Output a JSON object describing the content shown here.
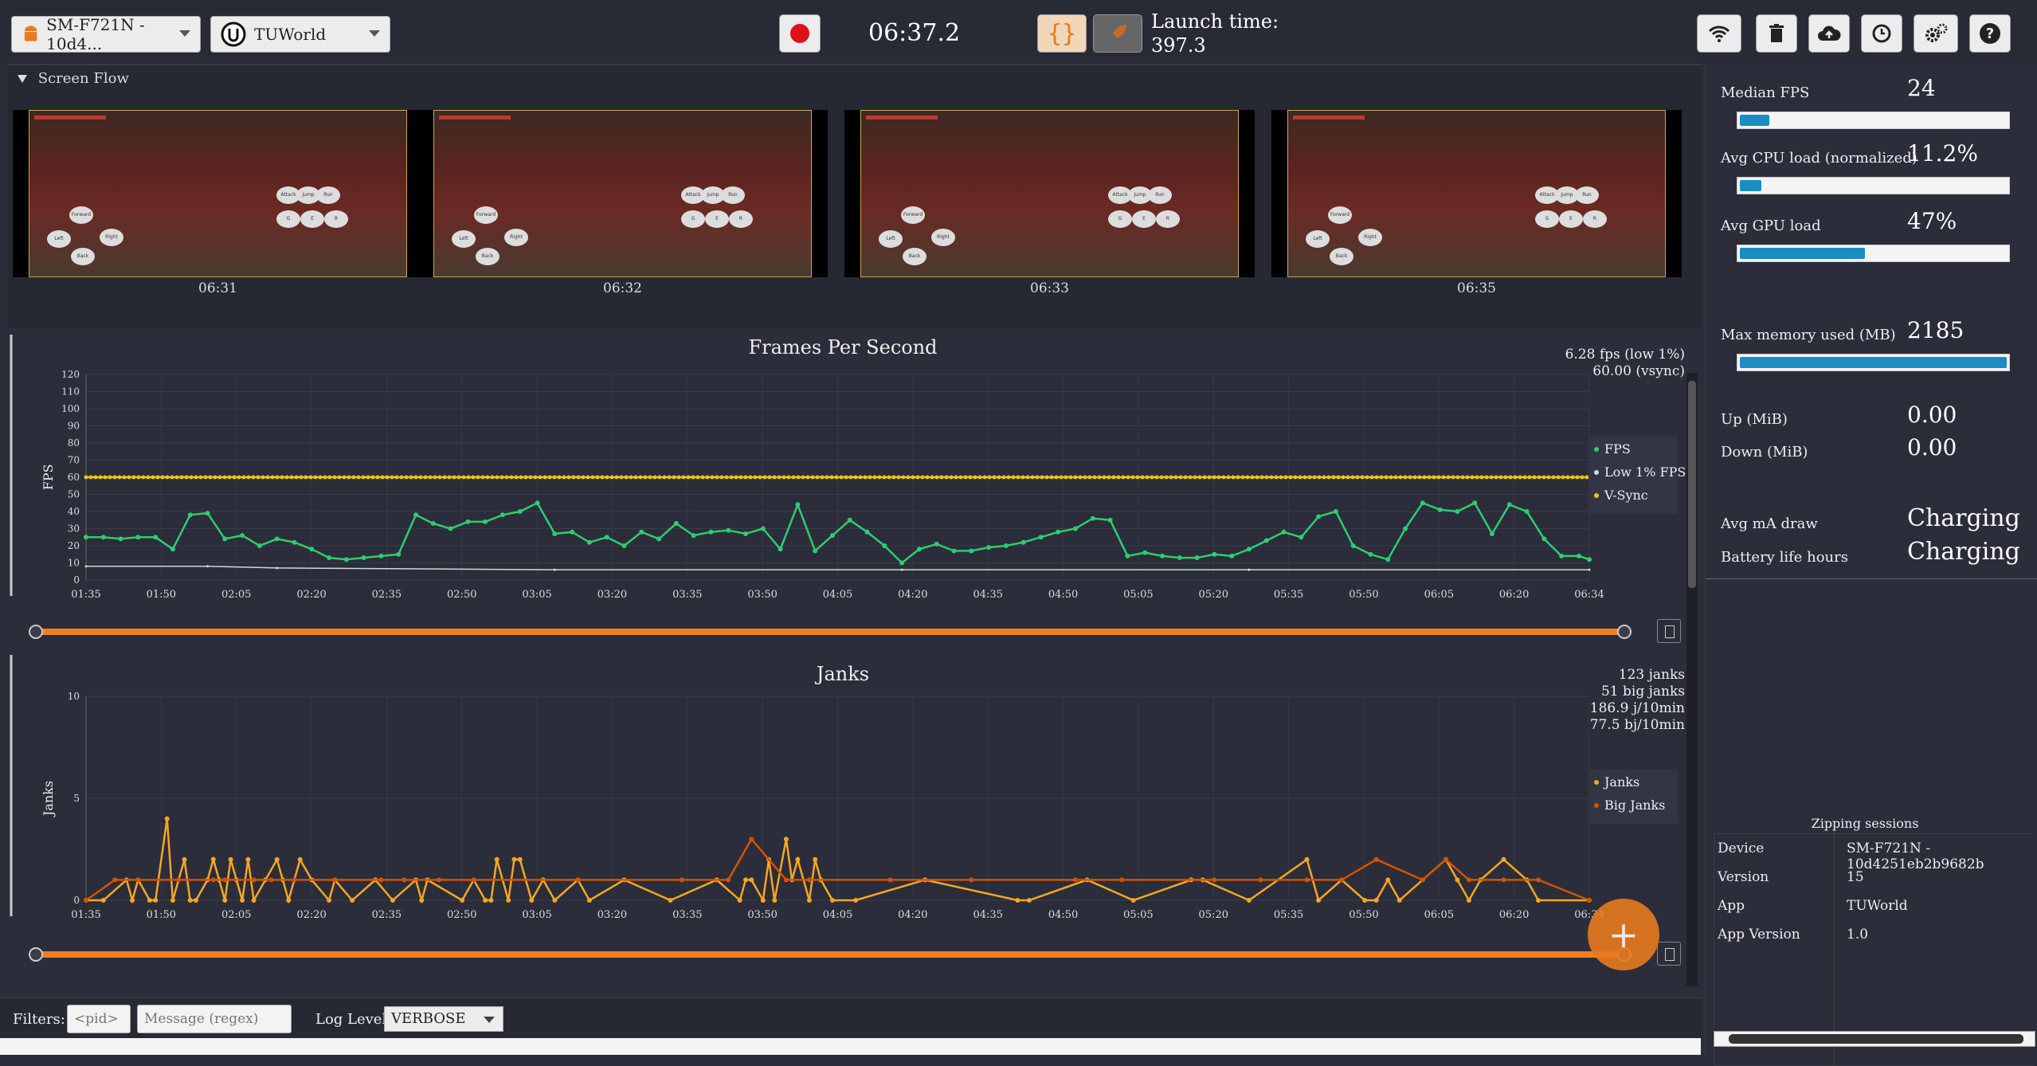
{
  "toolbar": {
    "device_select": "SM-F721N - 10d4...",
    "app_select": "TUWorld",
    "timer": "06:37.2",
    "launch_label": "Launch time:",
    "launch_value": "397.3",
    "icons": [
      "android-icon",
      "unreal-icon",
      "record-icon",
      "braces-icon",
      "rocket-icon",
      "wifi-icon",
      "trash-icon",
      "cloud-upload-icon",
      "clock-icon",
      "settings-icon",
      "help-icon"
    ]
  },
  "screen_flow": {
    "title": "Screen Flow",
    "thumbnails": [
      {
        "time": "06:31"
      },
      {
        "time": "06:32"
      },
      {
        "time": "06:33"
      },
      {
        "time": "06:35"
      }
    ],
    "touch_buttons": [
      "Forward",
      "Left",
      "Right",
      "Back",
      "Attack",
      "Jump",
      "Run",
      "G",
      "E",
      "R"
    ]
  },
  "fps_chart": {
    "title": "Frames Per Second",
    "stats": [
      "6.28 fps (low 1%)",
      "60.00 (vsync)"
    ],
    "ylabel": "FPS",
    "yticks": [
      "0",
      "10",
      "20",
      "30",
      "40",
      "50",
      "60",
      "70",
      "80",
      "90",
      "100",
      "110",
      "120"
    ],
    "xticks": [
      "01:35",
      "01:50",
      "02:05",
      "02:20",
      "02:35",
      "02:50",
      "03:05",
      "03:20",
      "03:35",
      "03:50",
      "04:05",
      "04:20",
      "04:35",
      "04:50",
      "05:05",
      "05:20",
      "05:35",
      "05:50",
      "06:05",
      "06:20",
      "06:34"
    ],
    "legend": [
      "FPS",
      "Low 1% FPS",
      "V-Sync"
    ],
    "colors": {
      "fps": "#2ecc71",
      "low": "#cfd8dc",
      "vsync": "#f1c40f"
    }
  },
  "janks_chart": {
    "title": "Janks",
    "stats": [
      "123 janks",
      "51 big janks",
      "186.9 j/10min",
      "77.5 bj/10min"
    ],
    "ylabel": "Janks",
    "yticks": [
      "0",
      "5",
      "10"
    ],
    "xticks": [
      "01:35",
      "01:50",
      "02:05",
      "02:20",
      "02:35",
      "02:50",
      "03:05",
      "03:20",
      "03:35",
      "03:50",
      "04:05",
      "04:20",
      "04:35",
      "04:50",
      "05:05",
      "05:20",
      "05:35",
      "05:50",
      "06:05",
      "06:20",
      "06:34"
    ],
    "legend": [
      "Janks",
      "Big Janks"
    ],
    "colors": {
      "janks": "#f5a623",
      "big": "#d35400"
    }
  },
  "chart_data": [
    {
      "type": "line",
      "title": "Frames Per Second",
      "ylabel": "FPS",
      "xlabel": "",
      "ylim": [
        0,
        120
      ],
      "x_range": [
        "01:35",
        "06:34"
      ],
      "series": [
        {
          "name": "FPS",
          "x_sec": [
            95,
            110,
            125,
            140,
            155,
            170,
            185,
            200,
            215,
            230,
            245,
            260,
            275,
            290,
            305,
            320,
            335,
            350,
            365,
            380,
            395,
            410,
            425,
            440,
            455,
            470,
            485,
            500,
            515,
            530,
            545,
            560,
            575,
            590,
            605,
            620,
            635,
            650,
            665,
            680,
            695,
            710,
            725,
            740,
            755,
            770,
            785,
            800,
            815,
            830,
            845,
            860,
            875,
            890,
            905,
            920,
            935,
            950,
            965,
            980,
            995,
            1010,
            1025,
            1040,
            1055,
            1070,
            1085,
            1100,
            1115,
            1130,
            1145,
            1160,
            1175,
            1190,
            1205,
            1220,
            1235,
            1250,
            1265,
            1280,
            1295,
            1310,
            1325,
            1340,
            1355,
            1370,
            1385,
            1394
          ],
          "values": [
            25,
            25,
            24,
            25,
            25,
            18,
            38,
            39,
            24,
            26,
            20,
            24,
            22,
            18,
            13,
            12,
            13,
            14,
            15,
            38,
            33,
            30,
            34,
            34,
            38,
            40,
            45,
            27,
            28,
            22,
            25,
            20,
            28,
            24,
            33,
            26,
            28,
            29,
            27,
            30,
            18,
            44,
            17,
            26,
            35,
            28,
            20,
            10,
            18,
            21,
            17,
            17,
            19,
            20,
            22,
            25,
            28,
            30,
            36,
            35,
            14,
            16,
            14,
            13,
            13,
            15,
            14,
            18,
            23,
            28,
            25,
            37,
            40,
            20,
            15,
            12,
            30,
            45,
            41,
            40,
            45,
            27,
            44,
            40,
            24,
            14,
            14,
            12
          ]
        },
        {
          "name": "Low 1% FPS",
          "x_sec": [
            95,
            200,
            260,
            500,
            800,
            1100,
            1394
          ],
          "values": [
            8,
            8,
            7,
            6,
            6,
            6,
            6
          ]
        },
        {
          "name": "V-Sync",
          "x_sec": [
            95,
            1394
          ],
          "values": [
            60,
            60
          ]
        }
      ]
    },
    {
      "type": "line",
      "title": "Janks",
      "ylabel": "Janks",
      "xlabel": "",
      "ylim": [
        0,
        10
      ],
      "x_range": [
        "01:35",
        "06:34"
      ],
      "series": [
        {
          "name": "Janks",
          "x_sec": [
            95,
            110,
            130,
            135,
            140,
            150,
            155,
            165,
            170,
            180,
            185,
            190,
            200,
            205,
            210,
            215,
            220,
            225,
            230,
            235,
            240,
            250,
            260,
            265,
            270,
            280,
            290,
            305,
            310,
            325,
            345,
            360,
            380,
            385,
            390,
            420,
            430,
            440,
            445,
            450,
            460,
            465,
            470,
            480,
            490,
            500,
            520,
            530,
            560,
            600,
            640,
            660,
            665,
            670,
            680,
            685,
            690,
            700,
            705,
            710,
            720,
            725,
            730,
            740,
            760,
            820,
            900,
            910,
            960,
            1000,
            1050,
            1060,
            1100,
            1150,
            1160,
            1180,
            1200,
            1210,
            1220,
            1230,
            1250,
            1270,
            1280,
            1290,
            1300,
            1320,
            1340,
            1350,
            1394
          ],
          "values": [
            0,
            0,
            1,
            0,
            1,
            0,
            0,
            4,
            0,
            2,
            0,
            0,
            1,
            2,
            1,
            0,
            2,
            1,
            0,
            2,
            0,
            1,
            2,
            1,
            0,
            2,
            1,
            0,
            1,
            0,
            1,
            0,
            1,
            0,
            1,
            0,
            1,
            0,
            0,
            2,
            0,
            2,
            2,
            0,
            1,
            0,
            1,
            0,
            1,
            0,
            1,
            0,
            1,
            1,
            0,
            2,
            0,
            3,
            1,
            2,
            0,
            2,
            1,
            0,
            0,
            1,
            0,
            0,
            1,
            0,
            1,
            1,
            0,
            2,
            0,
            1,
            0,
            0,
            1,
            0,
            1,
            2,
            1,
            0,
            1,
            2,
            1,
            0,
            0
          ]
        },
        {
          "name": "Big Janks",
          "x_sec": [
            95,
            120,
            140,
            175,
            205,
            215,
            240,
            255,
            275,
            310,
            350,
            370,
            400,
            430,
            520,
            610,
            650,
            670,
            700,
            720,
            790,
            860,
            950,
            990,
            1070,
            1110,
            1150,
            1180,
            1210,
            1250,
            1270,
            1290,
            1320,
            1350,
            1394
          ],
          "values": [
            0,
            1,
            1,
            1,
            1,
            1,
            1,
            1,
            1,
            1,
            1,
            1,
            1,
            1,
            1,
            1,
            1,
            3,
            1,
            1,
            1,
            1,
            1,
            1,
            1,
            1,
            1,
            1,
            2,
            1,
            2,
            1,
            1,
            1,
            0
          ]
        }
      ]
    }
  ],
  "right_panel": {
    "metrics": [
      {
        "label": "Median FPS",
        "value": "24",
        "bar": 0.11
      },
      {
        "label": "Avg CPU load (normalized)",
        "value": "11.2%",
        "bar": 0.08
      },
      {
        "label": "Avg GPU load",
        "value": "47%",
        "bar": 0.47
      },
      {
        "label": "Max memory used (MB)",
        "value": "2185",
        "bar": 1.0
      }
    ],
    "net": [
      {
        "label": "Up (MiB)",
        "value": "0.00"
      },
      {
        "label": "Down (MiB)",
        "value": "0.00"
      }
    ],
    "power": [
      {
        "label": "Avg mA draw",
        "value": "Charging"
      },
      {
        "label": "Battery life hours",
        "value": "Charging"
      }
    ],
    "session_title": "Zipping sessions",
    "session": [
      {
        "key": "Device",
        "value": "SM-F721N - 10d4251eb2b9682b"
      },
      {
        "key": "Version",
        "value": "15"
      },
      {
        "key": "App",
        "value": "TUWorld"
      },
      {
        "key": "App Version",
        "value": "1.0"
      }
    ]
  },
  "filters": {
    "label": "Filters:",
    "pid_placeholder": "<pid>",
    "message_placeholder": "Message (regex)",
    "log_level_label": "Log Level:",
    "log_level": "VERBOSE"
  },
  "fab": {
    "label": "+"
  }
}
